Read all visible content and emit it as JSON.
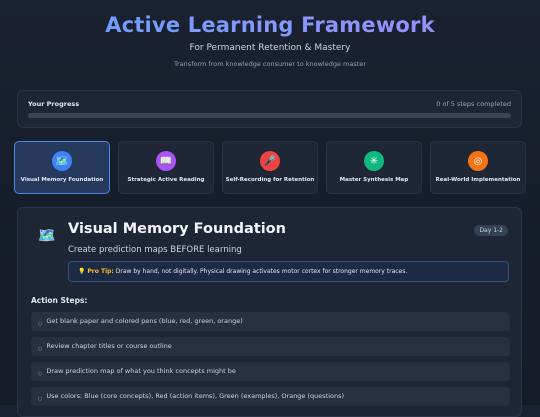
{
  "header": {
    "title": "Active Learning Framework",
    "subtitle": "For Permanent Retention & Mastery",
    "tagline": "Transform from knowledge consumer to knowledge master"
  },
  "progress": {
    "label": "Your Progress",
    "status": "0 of 5 steps completed",
    "completed": 0,
    "total": 5,
    "fill_fraction": 0
  },
  "steps": [
    {
      "label": "Visual Memory Foundation",
      "icon": "map-icon",
      "glyph": "🗺️",
      "color": "#3b82f6",
      "active": true
    },
    {
      "label": "Strategic Active Reading",
      "icon": "book-icon",
      "glyph": "📖",
      "color": "#a855f7",
      "active": false
    },
    {
      "label": "Self-Recording for Retention",
      "icon": "microphone-icon",
      "glyph": "🎤",
      "color": "#ef4444",
      "active": false
    },
    {
      "label": "Master Synthesis Map",
      "icon": "network-icon",
      "glyph": "✳",
      "color": "#10b981",
      "active": false
    },
    {
      "label": "Real-World Implementation",
      "icon": "target-icon",
      "glyph": "◎",
      "color": "#f97316",
      "active": false
    }
  ],
  "detail": {
    "icon": "map-icon",
    "glyph": "🗺️",
    "title": "Visual Memory Foundation",
    "badge": "Day 1-2",
    "subtitle": "Create prediction maps BEFORE learning",
    "tip_icon": "lightbulb-icon",
    "tip_glyph": "💡",
    "tip_label": "Pro Tip:",
    "tip_text": "Draw by hand, not digitally. Physical drawing activates motor cortex for stronger memory traces.",
    "actions_title": "Action Steps:",
    "actions": [
      "Get blank paper and colored pens (blue, red, green, orange)",
      "Review chapter titles or course outline",
      "Draw prediction map of what you think concepts might be",
      "Use colors: Blue (core concepts), Red (action items), Green (examples), Orange (questions)"
    ]
  }
}
